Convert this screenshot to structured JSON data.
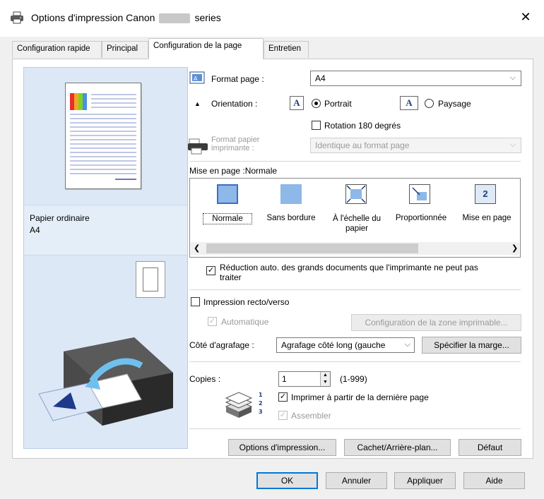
{
  "window": {
    "title_prefix": "Options d'impression Canon",
    "title_suffix": "series",
    "close_label": "✕"
  },
  "tabs": [
    {
      "label": "Configuration rapide"
    },
    {
      "label": "Principal"
    },
    {
      "label": "Configuration de la page"
    },
    {
      "label": "Entretien"
    }
  ],
  "preview": {
    "media_type": "Papier ordinaire",
    "paper_size": "A4"
  },
  "page_setup": {
    "page_size_label": "Format page :",
    "page_size_value": "A4",
    "orientation_label": "Orientation :",
    "portrait_label": "Portrait",
    "landscape_label": "Paysage",
    "orientation_selected": "Portrait",
    "rotate_label": "Rotation 180 degrés",
    "rotate_checked": false,
    "printer_paper_label_1": "Format papier",
    "printer_paper_label_2": "imprimante :",
    "printer_paper_value": "Identique au format page",
    "layout_title": "Mise en page :Normale",
    "layouts": [
      {
        "label": "Normale",
        "selected": true
      },
      {
        "label": "Sans bordure"
      },
      {
        "label": "À l'échelle du papier"
      },
      {
        "label": "Proportionnée"
      },
      {
        "label": "Mise en page"
      }
    ],
    "auto_reduce_label_1": "Réduction auto. des grands documents que l'imprimante ne peut pas",
    "auto_reduce_label_2": "traiter",
    "auto_reduce_checked": true,
    "duplex_label": "Impression recto/verso",
    "duplex_checked": false,
    "automatic_label": "Automatique",
    "automatic_checked": true,
    "print_area_button": "Configuration de la zone imprimable...",
    "stapling_label": "Côté d'agrafage :",
    "stapling_value": "Agrafage côté long (gauche",
    "margin_button": "Spécifier la marge...",
    "copies_label": "Copies :",
    "copies_value": "1",
    "copies_range": "(1-999)",
    "reverse_order_label": "Imprimer à partir de la dernière page",
    "reverse_order_checked": true,
    "collate_label": "Assembler",
    "collate_checked": true,
    "print_options_button": "Options d'impression...",
    "stamp_button": "Cachet/Arrière-plan...",
    "defaults_button": "Défaut"
  },
  "footer": {
    "ok": "OK",
    "cancel": "Annuler",
    "apply": "Appliquer",
    "help": "Aide"
  },
  "colors": {
    "accent": "#0078d7",
    "preview_bg": "#dce8f5",
    "layout_icon": "#6fa8dc"
  }
}
